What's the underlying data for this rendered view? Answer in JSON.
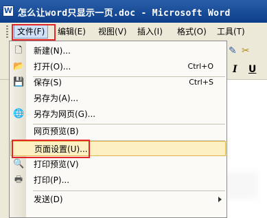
{
  "window": {
    "title": "怎么让word只显示一页.doc - Microsoft Word",
    "app_icon": "W"
  },
  "menubar": {
    "items": [
      {
        "label": "文件(F)"
      },
      {
        "label": "编辑(E)"
      },
      {
        "label": "视图(V)"
      },
      {
        "label": "插入(I)"
      },
      {
        "label": "格式(O)"
      },
      {
        "label": "工具(T)"
      }
    ]
  },
  "toolbar": {
    "italic": "I",
    "underline": "U"
  },
  "file_menu": {
    "items": [
      {
        "label": "新建(N)...",
        "shortcut": "",
        "icon": "new-doc-icon"
      },
      {
        "label": "打开(O)...",
        "shortcut": "Ctrl+O",
        "icon": "folder-open-icon"
      },
      {
        "label": "保存(S)",
        "shortcut": "Ctrl+S",
        "icon": "save-icon"
      },
      {
        "label": "另存为(A)...",
        "shortcut": "",
        "icon": ""
      },
      {
        "label": "另存为网页(G)...",
        "shortcut": "",
        "icon": "save-web-icon"
      },
      {
        "label": "网页预览(B)",
        "shortcut": "",
        "icon": ""
      },
      {
        "label": "页面设置(U)...",
        "shortcut": "",
        "icon": "",
        "highlighted": true
      },
      {
        "label": "打印预览(V)",
        "shortcut": "",
        "icon": "print-preview-icon"
      },
      {
        "label": "打印(P)...",
        "shortcut": "",
        "icon": "printer-icon"
      },
      {
        "label": "发送(D)",
        "shortcut": "",
        "icon": ""
      }
    ]
  }
}
